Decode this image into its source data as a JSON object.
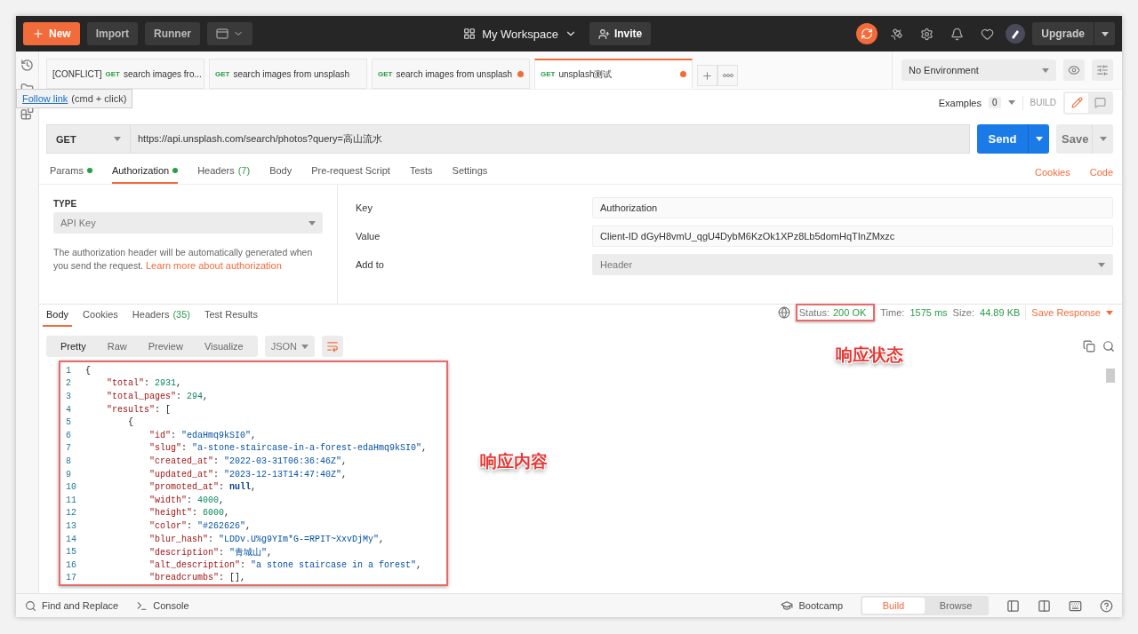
{
  "toolbar": {
    "new": "New",
    "import": "Import",
    "runner": "Runner",
    "workspace": "My Workspace",
    "invite": "Invite",
    "upgrade": "Upgrade"
  },
  "tabs": [
    {
      "prefix": "[CONFLICT]",
      "method": "GET",
      "title": "search images fro...",
      "unsaved": false,
      "selected": false
    },
    {
      "method": "GET",
      "title": "search images from unsplash",
      "unsaved": false,
      "selected": false
    },
    {
      "method": "GET",
      "title": "search images from unsplash",
      "unsaved": true,
      "selected": false
    },
    {
      "method": "GET",
      "title": "unsplash测试",
      "unsaved": true,
      "selected": true
    }
  ],
  "tooltip": {
    "link": "Follow link",
    "hint": "(cmd + click)"
  },
  "environment": "No Environment",
  "examples": {
    "label": "Examples",
    "count": "0"
  },
  "build_label": "BUILD",
  "request": {
    "method": "GET",
    "url": "https://api.unsplash.com/search/photos?query=高山流水",
    "send": "Send",
    "save": "Save"
  },
  "request_tabs": [
    {
      "label": "Params",
      "dot": true,
      "selected": false
    },
    {
      "label": "Authorization",
      "dot": true,
      "selected": true
    },
    {
      "label": "Headers",
      "count": "(7)",
      "dot": false,
      "selected": false
    },
    {
      "label": "Body",
      "dot": false,
      "selected": false
    },
    {
      "label": "Pre-request Script",
      "dot": false,
      "selected": false
    },
    {
      "label": "Tests",
      "dot": false,
      "selected": false
    },
    {
      "label": "Settings",
      "dot": false,
      "selected": false
    }
  ],
  "request_links": [
    "Cookies",
    "Code"
  ],
  "auth": {
    "type_label": "TYPE",
    "type": "API Key",
    "description": "The authorization header will be automatically generated when you send the request.",
    "learn_more": "Learn more about authorization",
    "fields": [
      {
        "label": "Key",
        "value": "Authorization",
        "kind": "input"
      },
      {
        "label": "Value",
        "value": "Client-ID dGyH8vmU_qgU4DybM6KzOk1XPz8Lb5domHqTInZMxzc",
        "kind": "input"
      },
      {
        "label": "Add to",
        "value": "Header",
        "kind": "select"
      }
    ]
  },
  "response_tabs": [
    {
      "label": "Body",
      "selected": true
    },
    {
      "label": "Cookies",
      "selected": false
    },
    {
      "label": "Headers",
      "count": "(35)",
      "selected": false
    },
    {
      "label": "Test Results",
      "selected": false
    }
  ],
  "response_meta": {
    "status_label": "Status:",
    "status": "200 OK",
    "time_label": "Time:",
    "time": "1575 ms",
    "size_label": "Size:",
    "size": "44.89 KB",
    "save": "Save Response"
  },
  "view_modes": [
    {
      "label": "Pretty",
      "selected": true
    },
    {
      "label": "Raw",
      "selected": false
    },
    {
      "label": "Preview",
      "selected": false
    },
    {
      "label": "Visualize",
      "selected": false
    }
  ],
  "format": "JSON",
  "code_lines": [
    {
      "num": "1",
      "tokens": [
        {
          "kind": "plain",
          "text": "{"
        }
      ]
    },
    {
      "num": "2",
      "tokens": [
        {
          "kind": "key",
          "text": "    \"total\""
        },
        {
          "kind": "plain",
          "text": ": "
        },
        {
          "kind": "number",
          "text": "2931"
        },
        {
          "kind": "plain",
          "text": ","
        }
      ]
    },
    {
      "num": "3",
      "tokens": [
        {
          "kind": "key",
          "text": "    \"total_pages\""
        },
        {
          "kind": "plain",
          "text": ": "
        },
        {
          "kind": "number",
          "text": "294"
        },
        {
          "kind": "plain",
          "text": ","
        }
      ]
    },
    {
      "num": "4",
      "tokens": [
        {
          "kind": "key",
          "text": "    \"results\""
        },
        {
          "kind": "plain",
          "text": ": ["
        }
      ]
    },
    {
      "num": "5",
      "tokens": [
        {
          "kind": "plain",
          "text": "        {"
        }
      ]
    },
    {
      "num": "6",
      "tokens": [
        {
          "kind": "key",
          "text": "            \"id\""
        },
        {
          "kind": "plain",
          "text": ": "
        },
        {
          "kind": "string",
          "text": "\"edaHmq9kSI0\""
        },
        {
          "kind": "plain",
          "text": ","
        }
      ]
    },
    {
      "num": "7",
      "tokens": [
        {
          "kind": "key",
          "text": "            \"slug\""
        },
        {
          "kind": "plain",
          "text": ": "
        },
        {
          "kind": "string",
          "text": "\"a-stone-staircase-in-a-forest-edaHmq9kSI0\""
        },
        {
          "kind": "plain",
          "text": ","
        }
      ]
    },
    {
      "num": "8",
      "tokens": [
        {
          "kind": "key",
          "text": "            \"created_at\""
        },
        {
          "kind": "plain",
          "text": ": "
        },
        {
          "kind": "string",
          "text": "\"2022-03-31T06:36:46Z\""
        },
        {
          "kind": "plain",
          "text": ","
        }
      ]
    },
    {
      "num": "9",
      "tokens": [
        {
          "kind": "key",
          "text": "            \"updated_at\""
        },
        {
          "kind": "plain",
          "text": ": "
        },
        {
          "kind": "string",
          "text": "\"2023-12-13T14:47:40Z\""
        },
        {
          "kind": "plain",
          "text": ","
        }
      ]
    },
    {
      "num": "10",
      "tokens": [
        {
          "kind": "key",
          "text": "            \"promoted_at\""
        },
        {
          "kind": "plain",
          "text": ": "
        },
        {
          "kind": "keyword",
          "text": "null"
        },
        {
          "kind": "plain",
          "text": ","
        }
      ]
    },
    {
      "num": "11",
      "tokens": [
        {
          "kind": "key",
          "text": "            \"width\""
        },
        {
          "kind": "plain",
          "text": ": "
        },
        {
          "kind": "number",
          "text": "4000"
        },
        {
          "kind": "plain",
          "text": ","
        }
      ]
    },
    {
      "num": "12",
      "tokens": [
        {
          "kind": "key",
          "text": "            \"height\""
        },
        {
          "kind": "plain",
          "text": ": "
        },
        {
          "kind": "number",
          "text": "6000"
        },
        {
          "kind": "plain",
          "text": ","
        }
      ]
    },
    {
      "num": "13",
      "tokens": [
        {
          "kind": "key",
          "text": "            \"color\""
        },
        {
          "kind": "plain",
          "text": ": "
        },
        {
          "kind": "string",
          "text": "\"#262626\""
        },
        {
          "kind": "plain",
          "text": ","
        }
      ]
    },
    {
      "num": "14",
      "tokens": [
        {
          "kind": "key",
          "text": "            \"blur_hash\""
        },
        {
          "kind": "plain",
          "text": ": "
        },
        {
          "kind": "string",
          "text": "\"LDDv.U%g9YIm*G-=RPIT~XxvDjMy\""
        },
        {
          "kind": "plain",
          "text": ","
        }
      ]
    },
    {
      "num": "15",
      "tokens": [
        {
          "kind": "key",
          "text": "            \"description\""
        },
        {
          "kind": "plain",
          "text": ": "
        },
        {
          "kind": "string",
          "text": "\"青城山\""
        },
        {
          "kind": "plain",
          "text": ","
        }
      ]
    },
    {
      "num": "16",
      "tokens": [
        {
          "kind": "key",
          "text": "            \"alt_description\""
        },
        {
          "kind": "plain",
          "text": ": "
        },
        {
          "kind": "string",
          "text": "\"a stone staircase in a forest\""
        },
        {
          "kind": "plain",
          "text": ","
        }
      ]
    },
    {
      "num": "17",
      "tokens": [
        {
          "kind": "key",
          "text": "            \"breadcrumbs\""
        },
        {
          "kind": "plain",
          "text": ": [],"
        }
      ]
    }
  ],
  "annotations": [
    {
      "text": "响应状态"
    },
    {
      "text": "响应内容"
    }
  ],
  "footer": {
    "find": "Find and Replace",
    "console": "Console",
    "bootcamp": "Bootcamp",
    "modes": [
      {
        "label": "Build",
        "selected": true
      },
      {
        "label": "Browse",
        "selected": false
      }
    ]
  }
}
